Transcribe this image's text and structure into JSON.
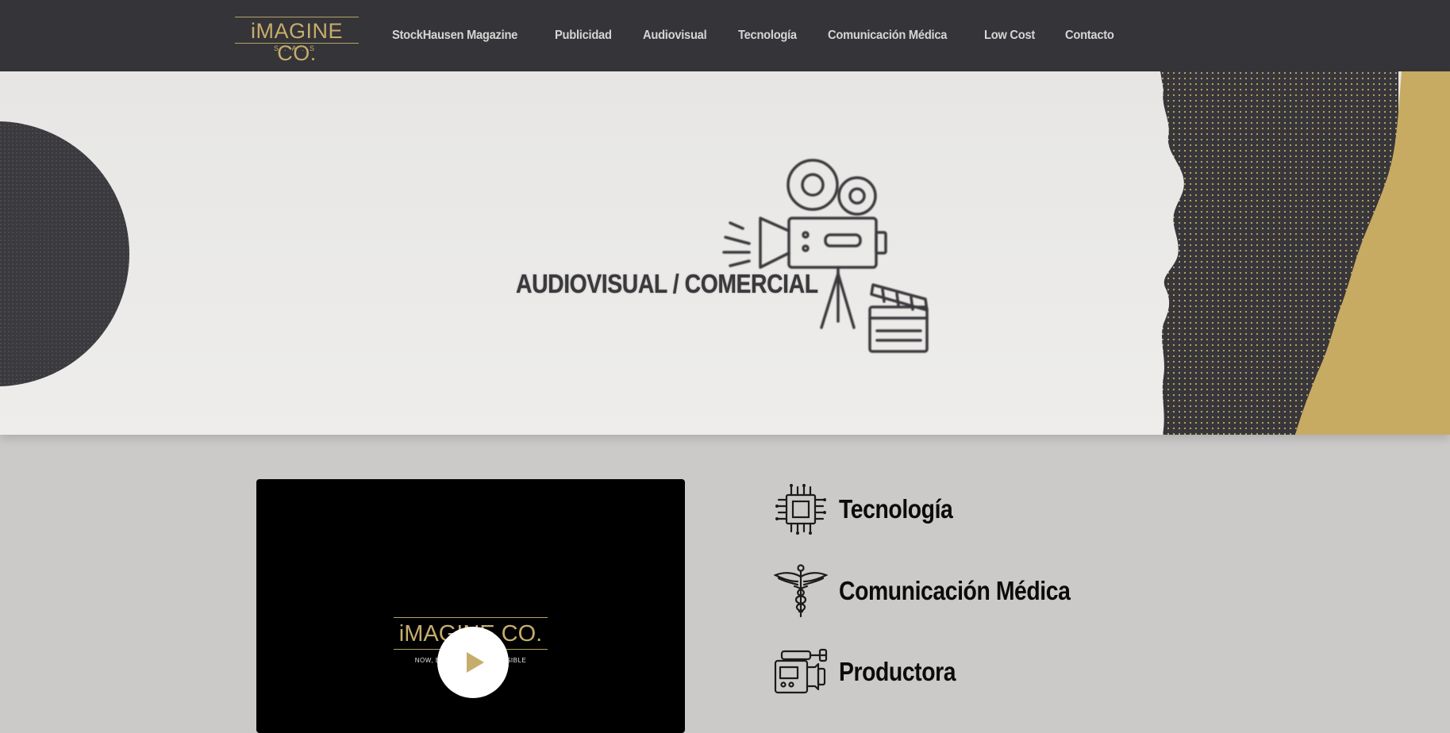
{
  "header": {
    "logo": {
      "main": "iMAGINE CO.",
      "sub": "S.A.S"
    },
    "nav": [
      {
        "label": "StockHausen Magazine"
      },
      {
        "label": "Publicidad"
      },
      {
        "label": "Audiovisual"
      },
      {
        "label": "Tecnología"
      },
      {
        "label": "Comunicación Médica"
      },
      {
        "label": "Low Cost"
      },
      {
        "label": "Contacto"
      }
    ]
  },
  "hero": {
    "title": "AUDIOVISUAL / COMERCIAL",
    "illustration": "film-camera-and-clapperboard-icon"
  },
  "video": {
    "logo_main": "iMAGINE CO.",
    "tagline": "NOW, EVERYTHING IS POSSIBLE",
    "play_icon": "play-icon"
  },
  "services": [
    {
      "label": "Tecnología",
      "icon": "chip-icon"
    },
    {
      "label": "Comunicación Médica",
      "icon": "caduceus-icon"
    },
    {
      "label": "Productora",
      "icon": "video-camera-icon"
    }
  ],
  "colors": {
    "header_bg": "#353438",
    "accent_gold": "#c6ad6c",
    "hero_bg": "#e9e8e6",
    "content_bg": "#cbcac9",
    "dark_texture": "#3a393e"
  }
}
